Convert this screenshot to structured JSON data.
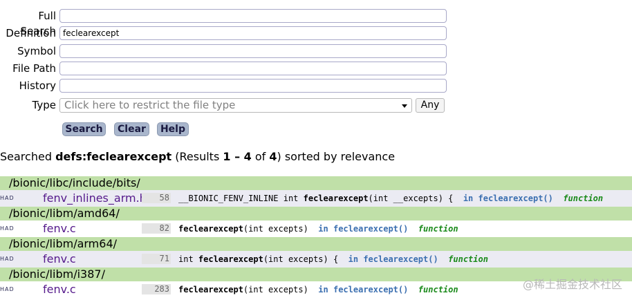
{
  "form": {
    "full_search": {
      "label": "Full Search",
      "value": ""
    },
    "definition": {
      "label": "Definition",
      "value": "feclearexcept"
    },
    "symbol": {
      "label": "Symbol",
      "value": ""
    },
    "file_path": {
      "label": "File Path",
      "value": ""
    },
    "history": {
      "label": "History",
      "value": ""
    },
    "type": {
      "label": "Type",
      "placeholder": "Click here to restrict the file type",
      "any_label": "Any"
    }
  },
  "buttons": {
    "search": "Search",
    "clear": "Clear",
    "help": "Help"
  },
  "summary": {
    "prefix": "Searched ",
    "query": "defs:feclearexcept",
    "mid1": " (Results ",
    "range": "1 – 4",
    "mid2": " of ",
    "total": "4",
    "suffix": ") sorted by relevance"
  },
  "results": [
    {
      "dir": "/bionic/libc/include/bits/",
      "had": "HAD",
      "file": "fenv_inlines_arm.h",
      "line": "58",
      "code_pre": "__BIONIC_FENV_INLINE int ",
      "code_fn": "feclearexcept",
      "code_post": "(int __excepts) {",
      "scope": "in feclearexcept()",
      "kind": "function"
    },
    {
      "dir": "/bionic/libm/amd64/",
      "had": "HAD",
      "file": "fenv.c",
      "line": "82",
      "code_pre": "",
      "code_fn": "feclearexcept",
      "code_post": "(int excepts)",
      "scope": "in feclearexcept()",
      "kind": "function"
    },
    {
      "dir": "/bionic/libm/arm64/",
      "had": "HAD",
      "file": "fenv.c",
      "line": "71",
      "code_pre": "int ",
      "code_fn": "feclearexcept",
      "code_post": "(int excepts) {",
      "scope": "in feclearexcept()",
      "kind": "function"
    },
    {
      "dir": "/bionic/libm/i387/",
      "had": "HAD",
      "file": "fenv.c",
      "line": "283",
      "code_pre": "",
      "code_fn": "feclearexcept",
      "code_post": "(int excepts)",
      "scope": "in feclearexcept()",
      "kind": "function"
    }
  ],
  "watermark": "@稀土掘金技术社区"
}
